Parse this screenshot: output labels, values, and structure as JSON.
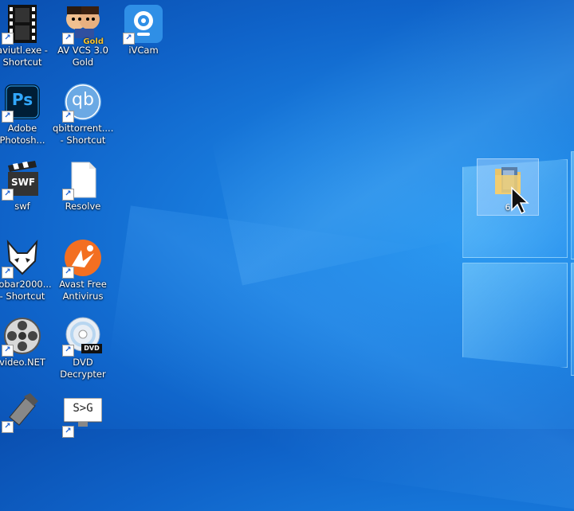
{
  "desktop": {
    "icons": [
      {
        "label": "aviutl.exe -\nShortcut",
        "icon": "film-strip-icon"
      },
      {
        "label": "AV VCS 3.0\nGold",
        "icon": "av-vcs-icon",
        "badge": "Gold"
      },
      {
        "label": "iVCam",
        "icon": "webcam-icon"
      },
      {
        "label": "Adobe\nPhotosh...",
        "icon": "photoshop-icon",
        "badge": "Ps"
      },
      {
        "label": "qbittorrent....\n- Shortcut",
        "icon": "qbittorrent-icon",
        "badge": "qb"
      },
      {
        "label": "swf",
        "icon": "swf-clapper-icon",
        "badge": "SWF"
      },
      {
        "label": "Resolve",
        "icon": "document-icon"
      },
      {
        "label": "oobar2000...\n- Shortcut",
        "icon": "foobar-fox-icon"
      },
      {
        "label": "Avast Free\nAntivirus",
        "icon": "avast-icon"
      },
      {
        "label": "video.NET",
        "icon": "film-reel-icon"
      },
      {
        "label": "DVD\nDecrypter",
        "icon": "dvd-icon",
        "badge": "DVD"
      },
      {
        "label": "",
        "icon": "tool-icon"
      },
      {
        "label": "",
        "icon": "s-g-monitor-icon",
        "badge": "S>G"
      }
    ],
    "dragged_item": {
      "label": "6",
      "icon": "folder-icon"
    }
  }
}
